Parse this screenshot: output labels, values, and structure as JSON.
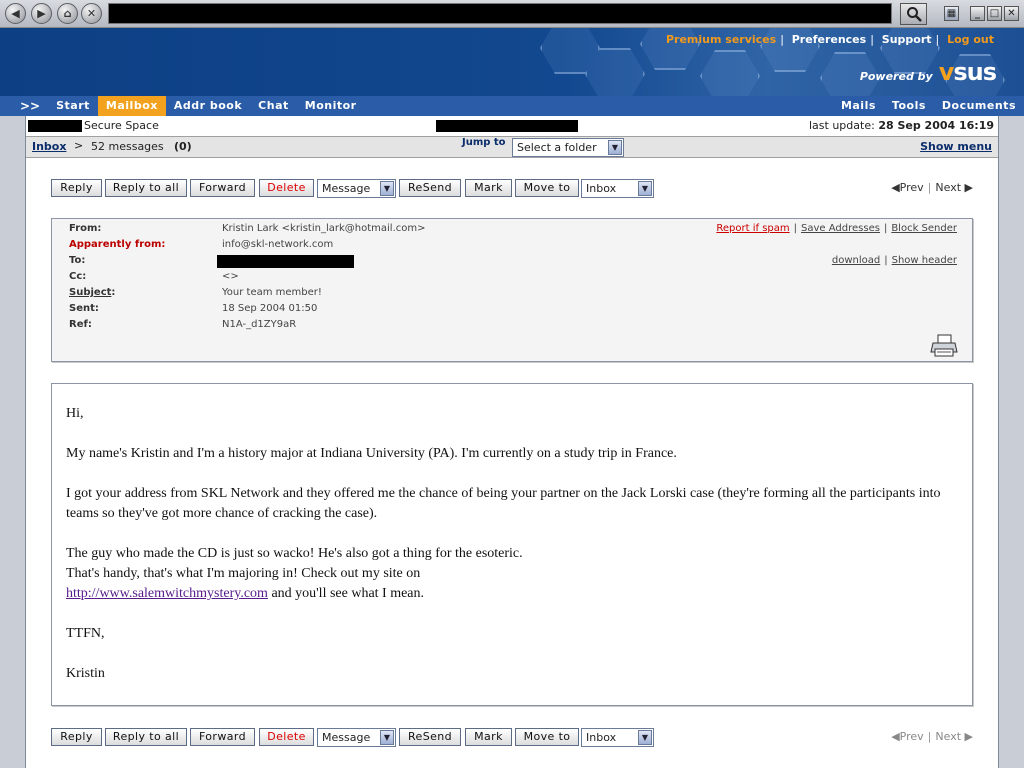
{
  "browser": {
    "address": "",
    "nav_icons": [
      "back-icon",
      "forward-icon",
      "home-icon",
      "close-icon"
    ]
  },
  "header": {
    "links": [
      {
        "label": "Premium services",
        "color": "#f39a1c"
      },
      {
        "label": "Preferences"
      },
      {
        "label": "Support"
      },
      {
        "label": "Log out",
        "color": "#f39a1c"
      }
    ],
    "powered_by": "Powered by",
    "logo": "vsus"
  },
  "nav": {
    "arrows": ">>",
    "left": [
      "Start",
      "Mailbox",
      "Addr book",
      "Chat",
      "Monitor"
    ],
    "active": "Mailbox",
    "right": [
      "Mails",
      "Tools",
      "Documents"
    ]
  },
  "infobar": {
    "secure_space": "Secure Space",
    "last_update_label": "last update:",
    "last_update_value": "28 Sep 2004 16:19"
  },
  "toolbar": {
    "inbox": "Inbox",
    "gt": ">",
    "messages": "52 messages",
    "unread": "(0)",
    "jump_to": "Jump to",
    "folder_select": "Select a folder",
    "show_menu": "Show menu"
  },
  "actions": {
    "reply": "Reply",
    "reply_all": "Reply to all",
    "forward": "Forward",
    "delete": "Delete",
    "message_select": "Message",
    "resend": "ReSend",
    "mark": "Mark",
    "move_to": "Move to",
    "folder": "Inbox",
    "prev": "Prev",
    "next": "Next"
  },
  "headers": {
    "from_label": "From:",
    "from_value": "Kristin Lark <kristin_lark@hotmail.com>",
    "apparently_label": "Apparently from:",
    "apparently_value": "info@skl-network.com",
    "to_label": "To:",
    "cc_label": "Cc:",
    "cc_value": "<>",
    "subject_label": "Subject",
    "subject_colon": ":",
    "subject_value": "Your team member!",
    "sent_label": "Sent:",
    "sent_value": "18 Sep 2004 01:50",
    "ref_label": "Ref:",
    "ref_value": "N1A-_d1ZY9aR",
    "report_spam": "Report if spam",
    "save_addresses": "Save Addresses",
    "block_sender": "Block Sender",
    "download": "download",
    "show_header": "Show header",
    "sep": "|"
  },
  "body": {
    "greeting": "Hi,",
    "p1": "My name's Kristin and I'm a history major at Indiana University (PA). I'm currently on a study trip in France.",
    "p2": "I got your address from SKL Network and they offered me the chance of being your partner on the Jack Lorski case (they're forming all the participants into teams so they've got more chance of cracking the case).",
    "p3_line1": "The guy who made the CD is just so wacko! He's also got a thing for the esoteric.",
    "p3_line2": "That's handy, that's what I'm majoring in! Check out my site on",
    "p3_link": "http://www.salemwitchmystery.com",
    "p3_line3": "and you'll see what I mean.",
    "closing": "TTFN,",
    "signature": "Kristin"
  }
}
